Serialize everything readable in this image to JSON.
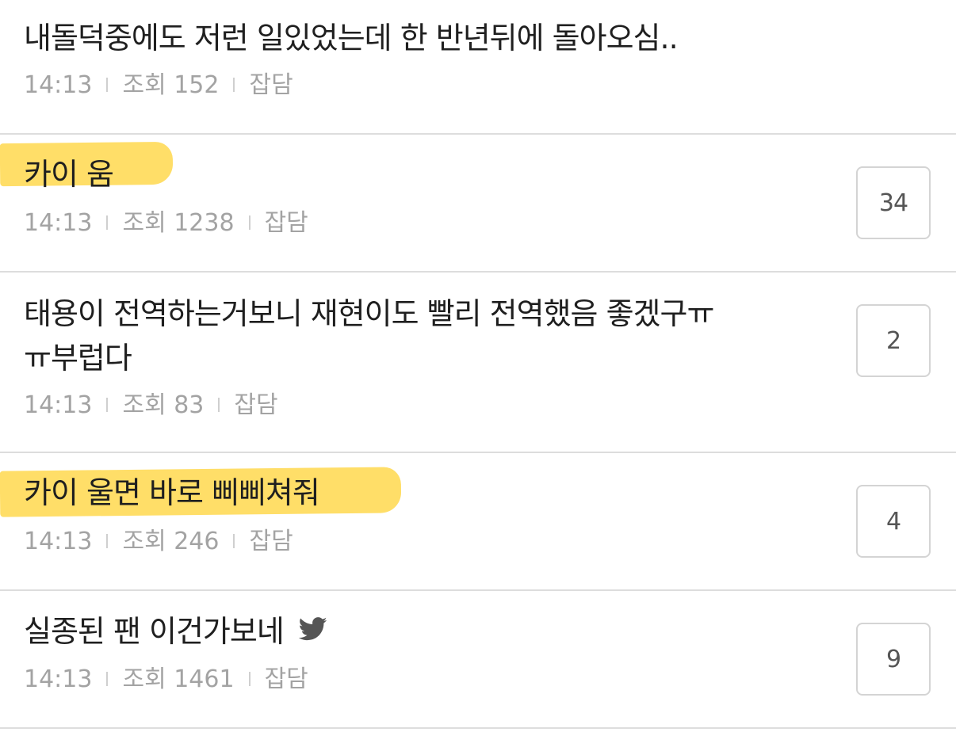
{
  "posts": [
    {
      "title": "내돌덕중에도 저런 일있었는데 한 반년뒤에 돌아오심..",
      "time": "14:13",
      "views": "조회 152",
      "board": "잡담",
      "comments": ""
    },
    {
      "title": "카이 움",
      "time": "14:13",
      "views": "조회 1238",
      "board": "잡담",
      "comments": "34"
    },
    {
      "title": "태용이 전역하는거보니 재현이도 빨리 전역했음 좋겠구ㅠ",
      "title_line2": "ㅠ부럽다",
      "time": "14:13",
      "views": "조회 83",
      "board": "잡담",
      "comments": "2"
    },
    {
      "title": "카이 울면 바로 삐삐쳐줘",
      "time": "14:13",
      "views": "조회 246",
      "board": "잡담",
      "comments": "4"
    },
    {
      "title": "실종된 팬 이건가보네",
      "time": "14:13",
      "views": "조회 1461",
      "board": "잡담",
      "comments": "9",
      "icon": "twitter-bird-icon"
    }
  ],
  "colors": {
    "highlight": "#ffd84d",
    "meta_text": "#a3a3a3",
    "title_text": "#1f1f1f",
    "divider": "#dddddd"
  }
}
